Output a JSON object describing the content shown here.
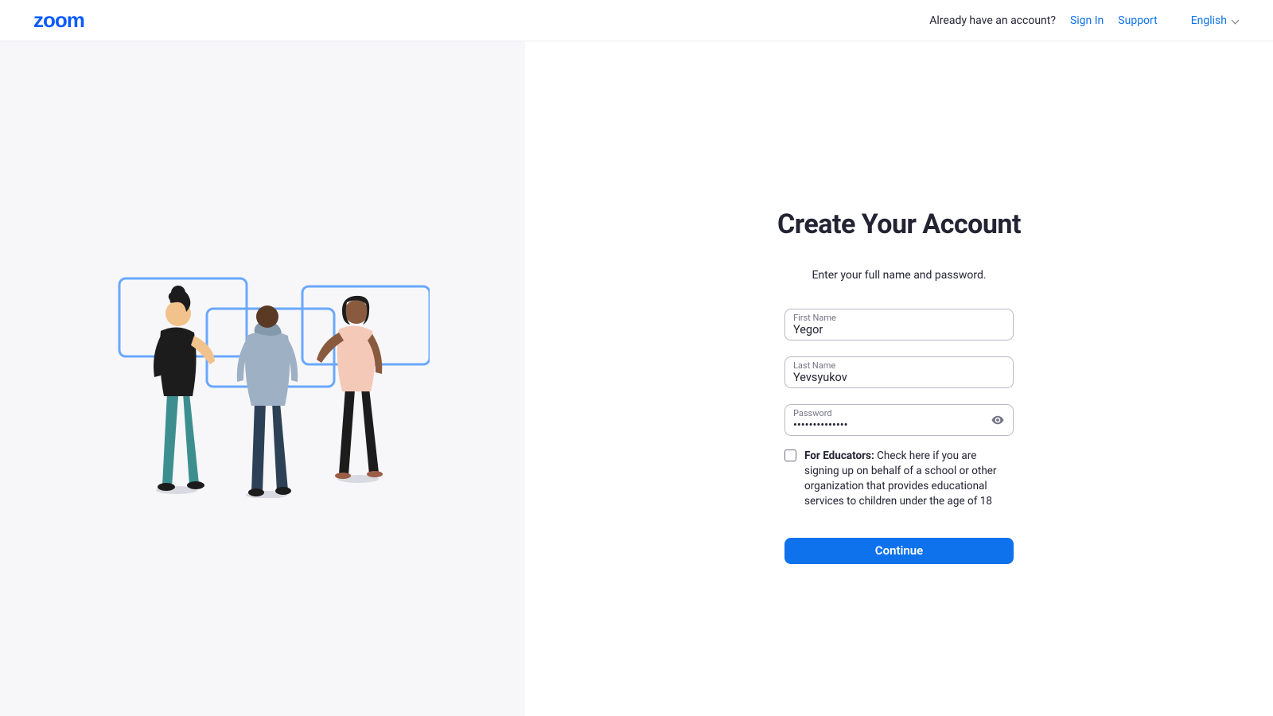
{
  "header": {
    "logo_text": "zoom",
    "already_text": "Already have an account?",
    "sign_in": "Sign In",
    "support": "Support",
    "language": "English"
  },
  "form": {
    "title": "Create Your Account",
    "subtitle": "Enter your full name and password.",
    "first_name_label": "First Name",
    "first_name_value": "Yegor",
    "last_name_label": "Last Name",
    "last_name_value": "Yevsyukov",
    "password_label": "Password",
    "password_value": "••••••••••••••",
    "educators_bold": "For Educators:",
    "educators_text": " Check here if you are signing up on behalf of a school or other organization that provides educational services to children under the age of 18",
    "continue_label": "Continue"
  }
}
